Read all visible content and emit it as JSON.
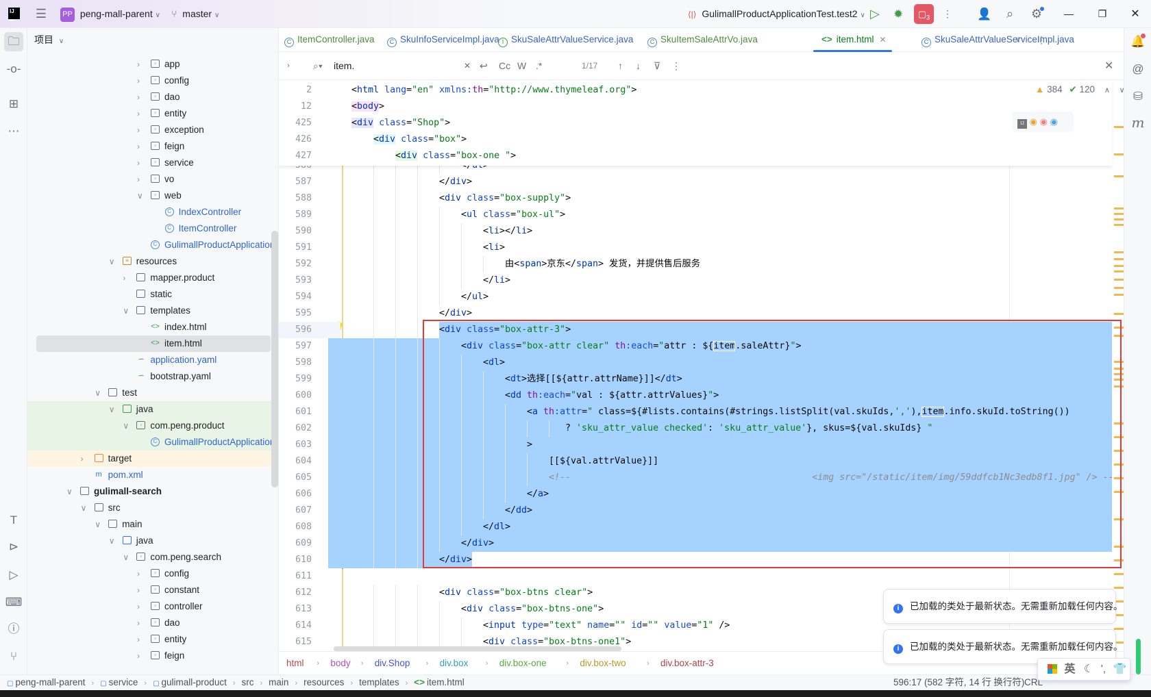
{
  "topbar": {
    "project_badge": "PP",
    "project_name": "peng-mall-parent",
    "branch": "master",
    "run_config": "GulimallProductApplicationTest.test2",
    "stop_badge": "3"
  },
  "project_panel": {
    "title": "项目",
    "tree": [
      {
        "d": 5,
        "label": "app",
        "kind": "pkg",
        "chev": "closed"
      },
      {
        "d": 5,
        "label": "config",
        "kind": "pkg",
        "chev": "closed"
      },
      {
        "d": 5,
        "label": "dao",
        "kind": "pkg",
        "chev": "closed"
      },
      {
        "d": 5,
        "label": "entity",
        "kind": "pkg",
        "chev": "closed"
      },
      {
        "d": 5,
        "label": "exception",
        "kind": "pkg",
        "chev": "closed"
      },
      {
        "d": 5,
        "label": "feign",
        "kind": "pkg",
        "chev": "closed"
      },
      {
        "d": 5,
        "label": "service",
        "kind": "pkg",
        "chev": "closed"
      },
      {
        "d": 5,
        "label": "vo",
        "kind": "pkg",
        "chev": "closed"
      },
      {
        "d": 5,
        "label": "web",
        "kind": "pkg",
        "chev": "open"
      },
      {
        "d": 6,
        "label": "IndexController",
        "kind": "class",
        "color": "#2f65ca"
      },
      {
        "d": 6,
        "label": "ItemController",
        "kind": "class",
        "color": "#2f65ca"
      },
      {
        "d": 5,
        "label": "GulimallProductApplication",
        "kind": "spring",
        "color": "#2f65ca"
      },
      {
        "d": 3,
        "label": "resources",
        "kind": "res",
        "chev": "open"
      },
      {
        "d": 4,
        "label": "mapper.product",
        "kind": "folder",
        "chev": "closed"
      },
      {
        "d": 4,
        "label": "static",
        "kind": "folder"
      },
      {
        "d": 4,
        "label": "templates",
        "kind": "folder",
        "chev": "open"
      },
      {
        "d": 5,
        "label": "index.html",
        "kind": "html"
      },
      {
        "d": 5,
        "label": "item.html",
        "kind": "html",
        "selected": true
      },
      {
        "d": 4,
        "label": "application.yaml",
        "kind": "yaml",
        "color": "#2f65ca"
      },
      {
        "d": 4,
        "label": "bootstrap.yaml",
        "kind": "yaml"
      },
      {
        "d": 2,
        "label": "test",
        "kind": "folder",
        "chev": "open"
      },
      {
        "d": 3,
        "label": "java",
        "kind": "testsrc",
        "chev": "open",
        "bg": "#e8f5e6"
      },
      {
        "d": 4,
        "label": "com.peng.product",
        "kind": "pkg",
        "chev": "open",
        "bg": "#e8f5e6"
      },
      {
        "d": 5,
        "label": "GulimallProductApplicationTest",
        "kind": "spring",
        "color": "#2f65ca",
        "bg": "#e8f5e6"
      },
      {
        "d": 1,
        "label": "target",
        "kind": "excluded",
        "chev": "closed",
        "bg": "#fdf4e3"
      },
      {
        "d": 1,
        "label": "pom.xml",
        "kind": "maven",
        "color": "#2f65ca"
      },
      {
        "d": 0,
        "label": "gulimall-search",
        "kind": "module",
        "chev": "open",
        "bold": true
      },
      {
        "d": 1,
        "label": "src",
        "kind": "folder",
        "chev": "open"
      },
      {
        "d": 2,
        "label": "main",
        "kind": "folder",
        "chev": "open"
      },
      {
        "d": 3,
        "label": "java",
        "kind": "src",
        "chev": "open"
      },
      {
        "d": 4,
        "label": "com.peng.search",
        "kind": "pkg",
        "chev": "open"
      },
      {
        "d": 5,
        "label": "config",
        "kind": "pkg",
        "chev": "closed"
      },
      {
        "d": 5,
        "label": "constant",
        "kind": "pkg",
        "chev": "closed"
      },
      {
        "d": 5,
        "label": "controller",
        "kind": "pkg",
        "chev": "closed"
      },
      {
        "d": 5,
        "label": "dao",
        "kind": "pkg",
        "chev": "closed"
      },
      {
        "d": 5,
        "label": "entity",
        "kind": "pkg",
        "chev": "closed"
      },
      {
        "d": 5,
        "label": "feign",
        "kind": "pkg",
        "chev": "closed"
      }
    ]
  },
  "tabs": [
    {
      "label": "ItemController.java",
      "icon": "C",
      "color": "#4f8a3c",
      "active": false
    },
    {
      "label": "SkuInfoServiceImpl.java",
      "icon": "C",
      "color": "#3b63c4",
      "active": false
    },
    {
      "label": "SkuSaleAttrValueService.java",
      "icon": "I",
      "color": "#3b63c4",
      "active": false
    },
    {
      "label": "SkuItemSaleAttrVo.java",
      "icon": "C",
      "color": "#4f8a3c",
      "active": false
    },
    {
      "label": "item.html",
      "icon": "<>",
      "color": "#067d17",
      "active": true
    },
    {
      "label": "SkuSaleAttrValueServiceImpl.java",
      "icon": "C",
      "color": "#3b63c4",
      "active": false
    }
  ],
  "find": {
    "query": "item.",
    "match_count": "1/17",
    "opt_case": "Cc",
    "opt_word": "W",
    "opt_regex": ".*"
  },
  "inspections": {
    "warnings": "384",
    "checks": "120"
  },
  "sticky_lines": [
    {
      "n": "2",
      "indent": 0,
      "t": [
        [
          "p",
          "<"
        ],
        [
          "tag",
          "html"
        ],
        [
          "x",
          " "
        ],
        [
          "attr",
          "lang"
        ],
        [
          "p",
          "="
        ],
        [
          "val",
          "\"en\""
        ],
        [
          "x",
          " "
        ],
        [
          "attr",
          "xmlns:"
        ],
        [
          "ns",
          "th"
        ],
        [
          "p",
          "="
        ],
        [
          "val",
          "\"http://www.thymeleaf.org\""
        ],
        [
          "p",
          ">"
        ]
      ]
    },
    {
      "n": "12",
      "indent": 0,
      "hl": "#fbe3f5",
      "t": [
        [
          "p",
          "<"
        ],
        [
          "tag",
          "body"
        ],
        [
          "p",
          ">"
        ]
      ]
    },
    {
      "n": "425",
      "indent": 0,
      "hl": "#e6e6fa",
      "t": [
        [
          "p",
          "<"
        ],
        [
          "tag",
          "div"
        ],
        [
          "x",
          " "
        ],
        [
          "attr",
          "class"
        ],
        [
          "p",
          "="
        ],
        [
          "val",
          "\"Shop\""
        ],
        [
          "p",
          ">"
        ]
      ]
    },
    {
      "n": "426",
      "indent": 4,
      "hl": "#e0f8fb",
      "t": [
        [
          "p",
          "<"
        ],
        [
          "tag",
          "div"
        ],
        [
          "x",
          " "
        ],
        [
          "attr",
          "class"
        ],
        [
          "p",
          "="
        ],
        [
          "val",
          "\"box\""
        ],
        [
          "p",
          ">"
        ]
      ]
    },
    {
      "n": "427",
      "indent": 8,
      "hl": "#e4f9e2",
      "t": [
        [
          "p",
          "<"
        ],
        [
          "tag",
          "div"
        ],
        [
          "x",
          " "
        ],
        [
          "attr",
          "class"
        ],
        [
          "p",
          "="
        ],
        [
          "val",
          "\"box-one \""
        ],
        [
          "p",
          ">"
        ]
      ]
    }
  ],
  "code_lines": [
    {
      "n": "586",
      "indent": 20,
      "t": [
        [
          "p",
          "</"
        ],
        [
          "tag",
          "ul"
        ],
        [
          "p",
          ">"
        ]
      ]
    },
    {
      "n": "587",
      "indent": 16,
      "t": [
        [
          "p",
          "</"
        ],
        [
          "tag",
          "div"
        ],
        [
          "p",
          ">"
        ]
      ]
    },
    {
      "n": "588",
      "indent": 16,
      "t": [
        [
          "p",
          "<"
        ],
        [
          "tag",
          "div"
        ],
        [
          "x",
          " "
        ],
        [
          "attr",
          "class"
        ],
        [
          "p",
          "="
        ],
        [
          "val",
          "\"box-supply\""
        ],
        [
          "p",
          ">"
        ]
      ]
    },
    {
      "n": "589",
      "indent": 20,
      "t": [
        [
          "p",
          "<"
        ],
        [
          "tag",
          "ul"
        ],
        [
          "x",
          " "
        ],
        [
          "attr",
          "class"
        ],
        [
          "p",
          "="
        ],
        [
          "val",
          "\"box-ul\""
        ],
        [
          "p",
          ">"
        ]
      ]
    },
    {
      "n": "590",
      "indent": 24,
      "t": [
        [
          "p",
          "<"
        ],
        [
          "tag",
          "li"
        ],
        [
          "p",
          "></"
        ],
        [
          "tag",
          "li"
        ],
        [
          "p",
          ">"
        ]
      ]
    },
    {
      "n": "591",
      "indent": 24,
      "t": [
        [
          "p",
          "<"
        ],
        [
          "tag",
          "li"
        ],
        [
          "p",
          ">"
        ]
      ]
    },
    {
      "n": "592",
      "indent": 28,
      "t": [
        [
          "x",
          "由"
        ],
        [
          "p",
          "<"
        ],
        [
          "tag",
          "span"
        ],
        [
          "p",
          ">"
        ],
        [
          "x",
          "京东"
        ],
        [
          "p",
          "</"
        ],
        [
          "tag",
          "span"
        ],
        [
          "p",
          ">"
        ],
        [
          "x",
          " 发货，并提供售后服务"
        ]
      ]
    },
    {
      "n": "593",
      "indent": 24,
      "t": [
        [
          "p",
          "</"
        ],
        [
          "tag",
          "li"
        ],
        [
          "p",
          ">"
        ]
      ]
    },
    {
      "n": "594",
      "indent": 20,
      "t": [
        [
          "p",
          "</"
        ],
        [
          "tag",
          "ul"
        ],
        [
          "p",
          ">"
        ]
      ]
    },
    {
      "n": "595",
      "indent": 16,
      "t": [
        [
          "p",
          "</"
        ],
        [
          "tag",
          "div"
        ],
        [
          "p",
          ">"
        ]
      ]
    },
    {
      "n": "596",
      "indent": 16,
      "current": true,
      "t": [
        [
          "p",
          "<"
        ],
        [
          "tag",
          "div"
        ],
        [
          "x",
          " "
        ],
        [
          "attr",
          "class"
        ],
        [
          "p",
          "="
        ],
        [
          "val",
          "\"box-attr-3\""
        ],
        [
          "p",
          ">"
        ]
      ]
    },
    {
      "n": "597",
      "indent": 20,
      "t": [
        [
          "p",
          "<"
        ],
        [
          "tag",
          "div"
        ],
        [
          "x",
          " "
        ],
        [
          "attr",
          "class"
        ],
        [
          "p",
          "="
        ],
        [
          "val",
          "\"box-attr clear\""
        ],
        [
          "x",
          " "
        ],
        [
          "ns",
          "th"
        ],
        [
          "attr",
          ":each"
        ],
        [
          "p",
          "="
        ],
        [
          "val",
          "\""
        ],
        [
          "x",
          "attr : ${"
        ],
        [
          "xm",
          "item"
        ],
        [
          "x",
          ".saleAttr}"
        ],
        [
          "val",
          "\""
        ],
        [
          "p",
          ">"
        ]
      ]
    },
    {
      "n": "598",
      "indent": 24,
      "t": [
        [
          "p",
          "<"
        ],
        [
          "tag",
          "dl"
        ],
        [
          "p",
          ">"
        ]
      ]
    },
    {
      "n": "599",
      "indent": 28,
      "t": [
        [
          "p",
          "<"
        ],
        [
          "tag",
          "dt"
        ],
        [
          "p",
          ">"
        ],
        [
          "x",
          "选择[[${attr.attrName}]]"
        ],
        [
          "p",
          "</"
        ],
        [
          "tag",
          "dt"
        ],
        [
          "p",
          ">"
        ]
      ]
    },
    {
      "n": "600",
      "indent": 28,
      "t": [
        [
          "p",
          "<"
        ],
        [
          "tag",
          "dd"
        ],
        [
          "x",
          " "
        ],
        [
          "ns",
          "th"
        ],
        [
          "attr",
          ":each"
        ],
        [
          "p",
          "="
        ],
        [
          "val",
          "\""
        ],
        [
          "x",
          "val : ${attr.attrValues}"
        ],
        [
          "val",
          "\""
        ],
        [
          "p",
          ">"
        ]
      ]
    },
    {
      "n": "601",
      "indent": 32,
      "t": [
        [
          "p",
          "<"
        ],
        [
          "tag",
          "a"
        ],
        [
          "x",
          " "
        ],
        [
          "ns",
          "th"
        ],
        [
          "attr",
          ":attr"
        ],
        [
          "p",
          "="
        ],
        [
          "val",
          "\""
        ],
        [
          "x",
          " class=${#lists.contains(#strings.listSplit(val.skuIds,"
        ],
        [
          "val",
          "','"
        ],
        [
          "x",
          "),"
        ],
        [
          "xm",
          "item"
        ],
        [
          "x",
          ".info.skuId.toString())"
        ]
      ]
    },
    {
      "n": "602",
      "indent": 39,
      "t": [
        [
          "x",
          "? "
        ],
        [
          "val",
          "'sku_attr_value checked'"
        ],
        [
          "x",
          ": "
        ],
        [
          "val",
          "'sku_attr_value'"
        ],
        [
          "x",
          "}, skus=${val.skuIds} "
        ],
        [
          "val",
          "\""
        ]
      ]
    },
    {
      "n": "603",
      "indent": 32,
      "t": [
        [
          "p",
          ">"
        ]
      ]
    },
    {
      "n": "604",
      "indent": 36,
      "t": [
        [
          "x",
          "[[${val.attrValue}]]"
        ]
      ]
    },
    {
      "n": "605",
      "indent": 36,
      "t": [
        [
          "cm",
          "<!--                                            <img src=\"/static/item/img/59ddfcb1Nc3edb8f1.jpg\" /> -->"
        ]
      ]
    },
    {
      "n": "606",
      "indent": 32,
      "t": [
        [
          "p",
          "</"
        ],
        [
          "tag",
          "a"
        ],
        [
          "p",
          ">"
        ]
      ]
    },
    {
      "n": "607",
      "indent": 28,
      "t": [
        [
          "p",
          "</"
        ],
        [
          "tag",
          "dd"
        ],
        [
          "p",
          ">"
        ]
      ]
    },
    {
      "n": "608",
      "indent": 24,
      "t": [
        [
          "p",
          "</"
        ],
        [
          "tag",
          "dl"
        ],
        [
          "p",
          ">"
        ]
      ]
    },
    {
      "n": "609",
      "indent": 20,
      "t": [
        [
          "p",
          "</"
        ],
        [
          "tag",
          "div"
        ],
        [
          "p",
          ">"
        ]
      ]
    },
    {
      "n": "610",
      "indent": 16,
      "t": [
        [
          "p",
          "</"
        ],
        [
          "tag",
          "div"
        ],
        [
          "p",
          ">"
        ]
      ]
    },
    {
      "n": "611",
      "indent": 16,
      "t": []
    },
    {
      "n": "612",
      "indent": 16,
      "t": [
        [
          "p",
          "<"
        ],
        [
          "tag",
          "div"
        ],
        [
          "x",
          " "
        ],
        [
          "attr",
          "class"
        ],
        [
          "p",
          "="
        ],
        [
          "val",
          "\"box-btns clear\""
        ],
        [
          "p",
          ">"
        ]
      ]
    },
    {
      "n": "613",
      "indent": 20,
      "t": [
        [
          "p",
          "<"
        ],
        [
          "tag",
          "div"
        ],
        [
          "x",
          " "
        ],
        [
          "attr",
          "class"
        ],
        [
          "p",
          "="
        ],
        [
          "val",
          "\"box-btns-one\""
        ],
        [
          "p",
          ">"
        ]
      ]
    },
    {
      "n": "614",
      "indent": 24,
      "t": [
        [
          "p",
          "<"
        ],
        [
          "tag",
          "input"
        ],
        [
          "x",
          " "
        ],
        [
          "attr",
          "type"
        ],
        [
          "p",
          "="
        ],
        [
          "val",
          "\"text\""
        ],
        [
          "x",
          " "
        ],
        [
          "attr",
          "name"
        ],
        [
          "p",
          "="
        ],
        [
          "val",
          "\"\""
        ],
        [
          "x",
          " "
        ],
        [
          "attr",
          "id"
        ],
        [
          "p",
          "="
        ],
        [
          "val",
          "\"\""
        ],
        [
          "x",
          " "
        ],
        [
          "attr",
          "value"
        ],
        [
          "p",
          "="
        ],
        [
          "val",
          "\"1\""
        ],
        [
          "x",
          " /"
        ],
        [
          "p",
          ">"
        ]
      ]
    },
    {
      "n": "615",
      "indent": 24,
      "t": [
        [
          "p",
          "<"
        ],
        [
          "tag",
          "div"
        ],
        [
          "x",
          " "
        ],
        [
          "attr",
          "class"
        ],
        [
          "p",
          "="
        ],
        [
          "val",
          "\"box-btns-one1\""
        ],
        [
          "p",
          ">"
        ]
      ]
    }
  ],
  "breadcrumb": [
    {
      "label": "html",
      "color": "#b5484a"
    },
    {
      "label": "body",
      "color": "#b14fc2"
    },
    {
      "label": "div.Shop",
      "color": "#4b4fcf"
    },
    {
      "label": "div.box",
      "color": "#2fa2b8"
    },
    {
      "label": "div.box-one",
      "color": "#57a83e"
    },
    {
      "label": "div.box-two",
      "color": "#b39b2a"
    },
    {
      "label": "div.box-attr-3",
      "color": "#b5404e"
    }
  ],
  "status": {
    "path": [
      "peng-mall-parent",
      "service",
      "gulimall-product",
      "src",
      "main",
      "resources",
      "templates",
      "item.html"
    ],
    "position": "596:17 (582 字符, 14 行 换行符)",
    "line_sep": "CRL"
  },
  "notifications": [
    {
      "text": "已加载的类处于最新状态。无需重新加载任何内容。"
    },
    {
      "text": "已加载的类处于最新状态。无需重新加载任何内容。"
    }
  ],
  "ime": {
    "mode": "英"
  },
  "colors": {
    "accent": "#3574f0",
    "selection": "#a6d2ff",
    "highlight_box": "#e53935",
    "stop": "#e55765"
  }
}
